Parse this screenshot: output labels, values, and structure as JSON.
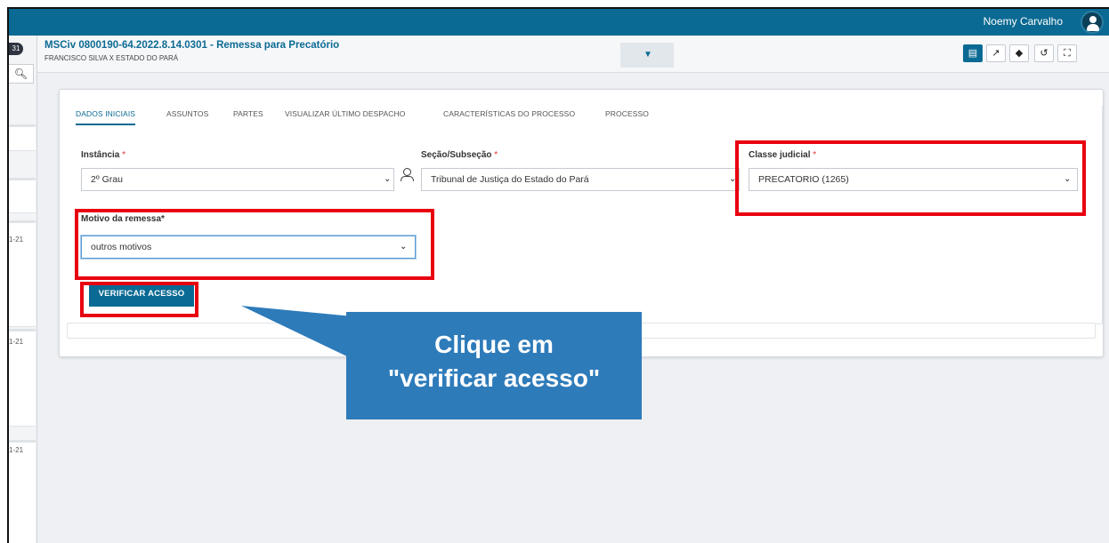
{
  "topbar": {
    "user_name": "Noemy Carvalho"
  },
  "left_panel": {
    "badge": "31",
    "dates": [
      "1-21",
      "1-21",
      "1-21"
    ]
  },
  "header": {
    "title": "MSCiv 0800190-64.2022.8.14.0301 - Remessa para Precatório",
    "parties": "FRANCISCO SILVA X ESTADO DO PARÁ",
    "dropdown_icon": "chevron-down-icon",
    "action_icons": [
      "document-icon",
      "share-icon",
      "tag-icon",
      "history-icon",
      "fullscreen-icon"
    ]
  },
  "tabs": [
    {
      "label": "DADOS INICIAIS",
      "active": true
    },
    {
      "label": "ASSUNTOS",
      "active": false
    },
    {
      "label": "PARTES",
      "active": false
    },
    {
      "label": "VISUALIZAR ÚLTIMO DESPACHO",
      "active": false
    },
    {
      "label": "CARACTERÍSTICAS DO PROCESSO",
      "active": false
    },
    {
      "label": "PROCESSO",
      "active": false
    }
  ],
  "form": {
    "instancia": {
      "label": "Instância",
      "required_mark": "*",
      "value": "2º Grau"
    },
    "secao": {
      "label": "Seção/Subseção",
      "required_mark": "*",
      "value": "Tribunal de Justiça do Estado do Pará"
    },
    "classe": {
      "label": "Classe judicial",
      "required_mark": "*",
      "value": "PRECATORIO (1265)"
    },
    "motivo": {
      "label": "Motivo da remessa*",
      "value": "outros motivos"
    },
    "verify_button": "VERIFICAR ACESSO"
  },
  "callout": {
    "line1": "Clique em",
    "line2": "\"verificar acesso\""
  },
  "colors": {
    "brand": "#0b6a93",
    "highlight": "#e8000f",
    "callout": "#2e7bba"
  }
}
